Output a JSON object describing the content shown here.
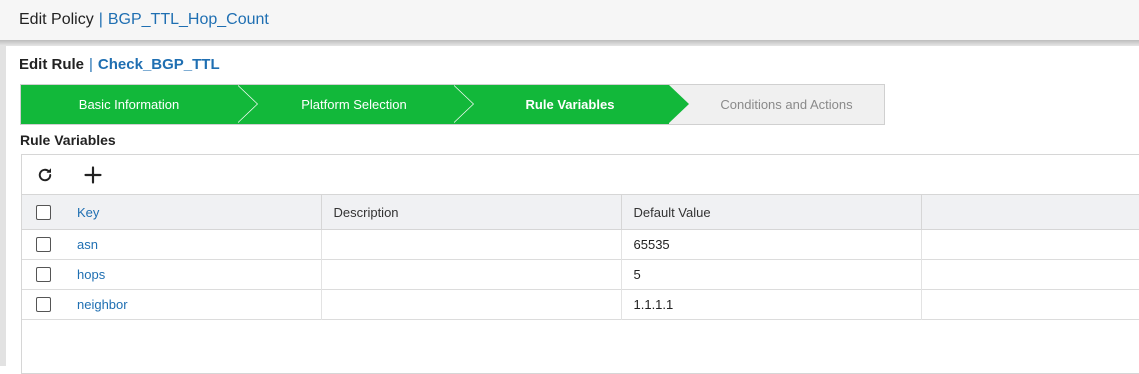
{
  "policy": {
    "label": "Edit Policy",
    "separator": "|",
    "name": "BGP_TTL_Hop_Count"
  },
  "rule": {
    "label": "Edit Rule",
    "separator": "|",
    "name": "Check_BGP_TTL"
  },
  "wizard": {
    "steps": [
      {
        "label": "Basic Information",
        "state": "done"
      },
      {
        "label": "Platform Selection",
        "state": "done"
      },
      {
        "label": "Rule Variables",
        "state": "current"
      },
      {
        "label": "Conditions and Actions",
        "state": "todo"
      }
    ],
    "accent_color": "#12b83a"
  },
  "section": {
    "title": "Rule Variables"
  },
  "toolbar": {
    "refresh_icon": "refresh-icon",
    "add_icon": "plus-icon"
  },
  "table": {
    "columns": [
      "Key",
      "Description",
      "Default Value",
      ""
    ],
    "rows": [
      {
        "key": "asn",
        "description": "",
        "default_value": "65535"
      },
      {
        "key": "hops",
        "description": "",
        "default_value": "5"
      },
      {
        "key": "neighbor",
        "description": "",
        "default_value": "1.1.1.1"
      }
    ]
  }
}
